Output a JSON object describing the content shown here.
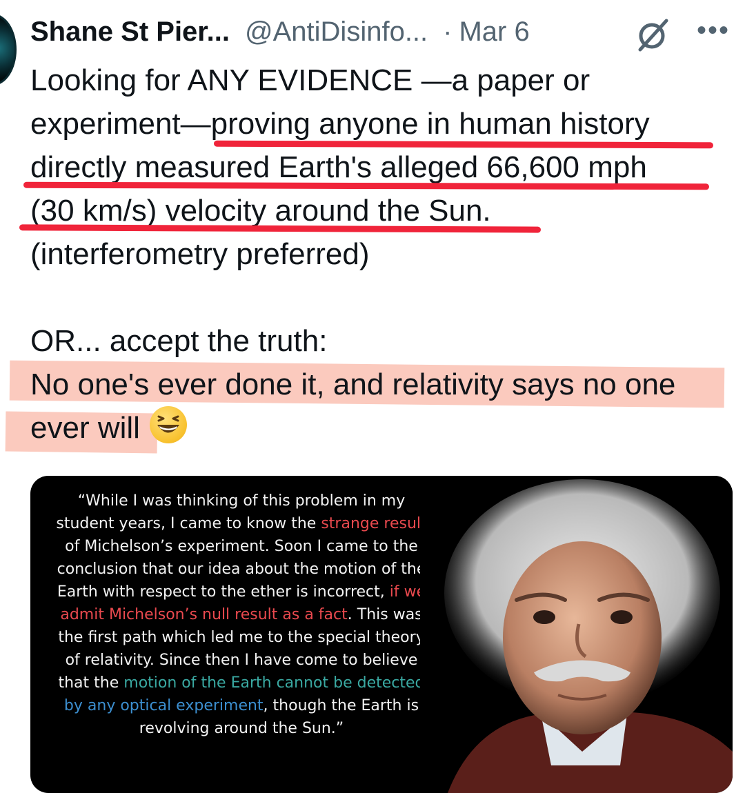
{
  "tweet": {
    "author_name": "Shane St Pier...",
    "author_handle": "@AntiDisinfo...",
    "separator": "·",
    "date": "Mar 6",
    "more_label": "•••",
    "text_lines": [
      "Looking for ANY EVIDENCE —a paper or",
      "experiment—proving anyone in human history",
      "directly measured Earth's alleged 66,600 mph",
      "(30 km/s) velocity around the Sun.",
      "(interferometry preferred)",
      "OR... accept the truth:",
      "No one's ever done it, and relativity says no one",
      "ever will"
    ],
    "emoji": "grinning-squinting-face"
  },
  "media": {
    "quote": {
      "l1": "“While I was thinking of this problem in my",
      "l2a": "student years, I came to know the ",
      "l2b": "strange result",
      "l3": "of Michelson’s experiment. Soon I came to the",
      "l4": "conclusion that our idea about the motion of the",
      "l5a": "Earth with respect to the ether is incorrect, ",
      "l5b": "if we",
      "l6a": "admit Michelson’s null result as a fact",
      "l6b": ". This was",
      "l7": "the first path which led me to the special theory",
      "l8": "of relativity. Since then I have come to believe",
      "l9a": "that the ",
      "l9b": "motion of the Earth cannot be detected",
      "l10a": "by any optical experiment",
      "l10b": ", though the Earth is",
      "l11": "revolving around the Sun.”"
    },
    "highlight_colors": {
      "red": "#e9494e",
      "teal": "#3aa9a2",
      "blue": "#3c8fd0"
    }
  },
  "annotations": {
    "underline_color": "#f0243a",
    "highlight_color": "#f8aa96"
  }
}
